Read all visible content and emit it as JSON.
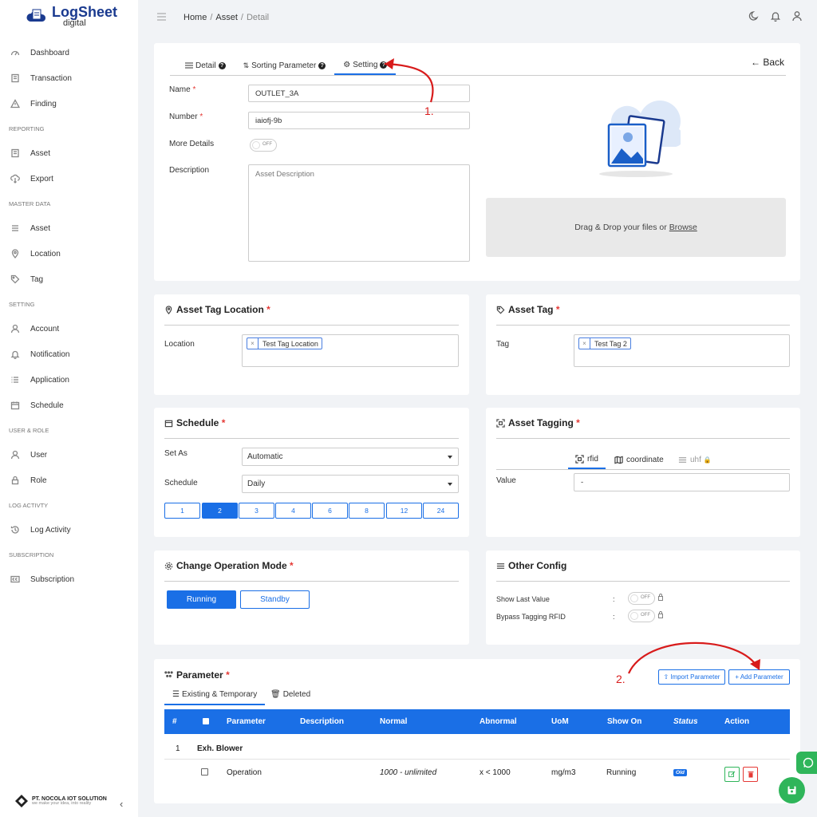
{
  "app": {
    "logo_main": "LogSheet",
    "logo_sub": "digital",
    "company_name": "PT. NOCOLA IOT SOLUTION",
    "company_tagline": "we make your idea, into reality"
  },
  "sidebar": {
    "top": [
      {
        "label": "Dashboard",
        "icon": "gauge-icon"
      },
      {
        "label": "Transaction",
        "icon": "file-icon"
      },
      {
        "label": "Finding",
        "icon": "warning-icon"
      }
    ],
    "sections": [
      {
        "title": "REPORTING",
        "items": [
          {
            "label": "Asset",
            "icon": "file-icon"
          },
          {
            "label": "Export",
            "icon": "cloud-download-icon"
          }
        ]
      },
      {
        "title": "MASTER DATA",
        "items": [
          {
            "label": "Asset",
            "icon": "list-icon"
          },
          {
            "label": "Location",
            "icon": "pin-icon"
          },
          {
            "label": "Tag",
            "icon": "tag-icon"
          }
        ]
      },
      {
        "title": "SETTING",
        "items": [
          {
            "label": "Account",
            "icon": "user-icon"
          },
          {
            "label": "Notification",
            "icon": "bell-icon"
          },
          {
            "label": "Application",
            "icon": "list-icon"
          },
          {
            "label": "Schedule",
            "icon": "calendar-icon"
          }
        ]
      },
      {
        "title": "USER & ROLE",
        "items": [
          {
            "label": "User",
            "icon": "user-icon"
          },
          {
            "label": "Role",
            "icon": "lock-icon"
          }
        ]
      },
      {
        "title": "LOG ACTIVTY",
        "items": [
          {
            "label": "Log Activity",
            "icon": "history-icon"
          }
        ]
      },
      {
        "title": "SUBSCRIPTION",
        "items": [
          {
            "label": "Subscription",
            "icon": "cc-icon"
          }
        ]
      }
    ]
  },
  "breadcrumb": {
    "home": "Home",
    "sep": "/",
    "asset": "Asset",
    "current": "Detail"
  },
  "detail_tabs": {
    "detail": "Detail",
    "sorting": "Sorting Parameter",
    "setting": "Setting",
    "back": "Back"
  },
  "form": {
    "name_label": "Name",
    "name_value": "OUTLET_3A",
    "number_label": "Number",
    "number_value": "iaiofj-9b",
    "more_label": "More Details",
    "toggle_off": "OFF",
    "desc_label": "Description",
    "desc_placeholder": "Asset Description",
    "required_mark": "*"
  },
  "upload": {
    "text": "Drag & Drop your files or",
    "browse": "Browse"
  },
  "tag_location": {
    "title": "Asset Tag Location",
    "label": "Location",
    "chip": "Test Tag Location",
    "chip_x": "×"
  },
  "asset_tag": {
    "title": "Asset Tag",
    "label": "Tag",
    "chip": "Test Tag 2"
  },
  "schedule": {
    "title": "Schedule",
    "set_as_label": "Set As",
    "set_as_value": "Automatic",
    "schedule_label": "Schedule",
    "schedule_value": "Daily",
    "hours": [
      "1",
      "2",
      "3",
      "4",
      "6",
      "8",
      "12",
      "24"
    ],
    "active_hour": "2"
  },
  "asset_tagging": {
    "title": "Asset Tagging",
    "tabs": [
      "rfid",
      "coordinate",
      "uhf"
    ],
    "value_label": "Value",
    "value": "-"
  },
  "op_mode": {
    "title": "Change Operation Mode",
    "running": "Running",
    "standby": "Standby"
  },
  "other_config": {
    "title": "Other Config",
    "show_last": "Show Last Value",
    "bypass": "Bypass Tagging RFID",
    "colon": ":",
    "toggle_off": "OFF"
  },
  "parameter": {
    "title": "Parameter",
    "import_btn": "Import Parameter",
    "add_btn": "+ Add Parameter",
    "tab_existing": "Existing & Temporary",
    "tab_deleted": "Deleted",
    "columns": [
      "#",
      "Parameter",
      "Description",
      "Normal",
      "Abnormal",
      "UoM",
      "Show On",
      "Status",
      "Action"
    ],
    "group": {
      "num": "1",
      "name": "Exh. Blower"
    },
    "rows": [
      {
        "parameter": "Operation",
        "description": "",
        "normal": "1000 - unlimited",
        "abnormal": "x < 1000",
        "uom": "mg/m3",
        "show_on": "Running",
        "status": "Old"
      }
    ]
  },
  "annotations": {
    "a1": "1.",
    "a2": "2."
  },
  "colors": {
    "primary": "#1a6fe6",
    "annotation": "#d81b1b",
    "success": "#2fb55a",
    "danger": "#e53935"
  }
}
